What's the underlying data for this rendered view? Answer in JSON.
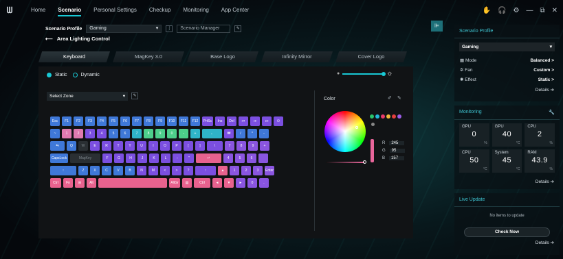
{
  "topbar": {
    "logo": "ᗯ",
    "nav": [
      "Home",
      "Scenario",
      "Personal Settings",
      "Checkup",
      "Monitoring",
      "App Center"
    ],
    "active": "Scenario",
    "icons": [
      "✋",
      "🎧",
      "⚙",
      "—",
      "⧉",
      "✕"
    ]
  },
  "scenario": {
    "profile_label": "Scenario Profile",
    "profile_value": "Gaming",
    "manager": "Scenario Manager",
    "page_title": "Area Lighting Control"
  },
  "tabs": [
    "Keyboard",
    "MagKey 3.0",
    "Base Logo",
    "Infinity Mirror",
    "Cover Logo"
  ],
  "lighting": {
    "static": "Static",
    "dynamic": "Dynamic",
    "zone": "Select Zone",
    "color_label": "Color",
    "r": "245",
    "g": "95",
    "b": "157",
    "r_label": "R",
    "g_label": "G",
    "b_label": "B"
  },
  "swatches": [
    "#29c46a",
    "#22b8d8",
    "#e93b6a",
    "#f0b93a",
    "#e33f3f",
    "#9b5de5"
  ],
  "keyboard": [
    [
      [
        "Esc",
        "k-blue",
        14
      ],
      [
        "F1",
        "k-blue",
        14
      ],
      [
        "F2",
        "k-blue",
        14
      ],
      [
        "F3",
        "k-blue",
        14
      ],
      [
        "F4",
        "k-blue",
        14
      ],
      [
        "F5",
        "k-blue",
        14
      ],
      [
        "F6",
        "k-blue",
        14
      ],
      [
        "F7",
        "k-blue",
        14
      ],
      [
        "F8",
        "k-blue",
        14
      ],
      [
        "F9",
        "k-blue",
        14
      ],
      [
        "F10",
        "k-blue",
        14
      ],
      [
        "F11",
        "k-blue",
        14
      ],
      [
        "F12",
        "k-blue",
        14
      ],
      [
        "PrtSc",
        "k-purple",
        16
      ],
      [
        "Ins",
        "k-purple",
        14
      ],
      [
        "Del",
        "k-purple",
        14
      ],
      [
        "⏮",
        "k-purple",
        14
      ],
      [
        "⏯",
        "k-purple",
        14
      ],
      [
        "⏭",
        "k-purple",
        14
      ],
      [
        "⏻",
        "k-purple",
        14
      ]
    ],
    [
      [
        "~",
        "k-blue",
        14
      ],
      [
        "1",
        "k-pink",
        14
      ],
      [
        "2",
        "k-pink",
        14
      ],
      [
        "3",
        "k-purple",
        14
      ],
      [
        "4",
        "k-purple",
        14
      ],
      [
        "5",
        "k-blue",
        14
      ],
      [
        "6",
        "k-blue",
        14
      ],
      [
        "7",
        "k-teal",
        14
      ],
      [
        "8",
        "k-green",
        14
      ],
      [
        "9",
        "k-green",
        14
      ],
      [
        "0",
        "k-green",
        14
      ],
      [
        "-",
        "k-green",
        14
      ],
      [
        "+",
        "k-teal",
        14
      ],
      [
        "←",
        "k-teal",
        29
      ],
      [
        "₩",
        "k-purple",
        14
      ],
      [
        "/",
        "k-blue",
        14
      ],
      [
        "*",
        "k-blue",
        14
      ],
      [
        "-",
        "k-blue",
        14
      ]
    ],
    [
      [
        "⇆",
        "k-blue",
        21
      ],
      [
        "Q",
        "k-blue",
        14
      ],
      [
        "W",
        "k-gray",
        14
      ],
      [
        "E",
        "k-purple",
        14
      ],
      [
        "R",
        "k-purple",
        14
      ],
      [
        "T",
        "k-purple",
        14
      ],
      [
        "Y",
        "k-purple",
        14
      ],
      [
        "U",
        "k-purple",
        14
      ],
      [
        "I",
        "k-purple",
        14
      ],
      [
        "O",
        "k-purple",
        14
      ],
      [
        "P",
        "k-purple",
        14
      ],
      [
        "[",
        "k-purple",
        14
      ],
      [
        "]",
        "k-purple",
        14
      ],
      [
        "\\",
        "k-purple",
        23
      ],
      [
        "7",
        "k-mag",
        14
      ],
      [
        "8",
        "k-mag",
        14
      ],
      [
        "9",
        "k-mag",
        14
      ],
      [
        "+",
        "k-mag",
        14
      ]
    ],
    [
      [
        "CapsLock",
        "k-blue",
        26
      ],
      [
        "MagKey",
        "k-gray",
        44
      ],
      [
        "F",
        "k-purple",
        14
      ],
      [
        "G",
        "k-purple",
        14
      ],
      [
        "H",
        "k-purple",
        14
      ],
      [
        "J",
        "k-purple",
        14
      ],
      [
        "K",
        "k-purple",
        14
      ],
      [
        "L",
        "k-purple",
        14
      ],
      [
        ":",
        "k-purple",
        14
      ],
      [
        "\"",
        "k-purple",
        14
      ],
      [
        "↵",
        "k-rose",
        37
      ],
      [
        "4",
        "k-mag",
        14
      ],
      [
        "5",
        "k-mag",
        14
      ],
      [
        "6",
        "k-mag",
        14
      ],
      [
        "",
        "k-mag",
        14
      ]
    ],
    [
      [
        "↑",
        "k-blue",
        38
      ],
      [
        "Z",
        "k-blue",
        14
      ],
      [
        "X",
        "k-blue",
        14
      ],
      [
        "C",
        "k-blue",
        14
      ],
      [
        "V",
        "k-blue",
        14
      ],
      [
        "B",
        "k-blue",
        14
      ],
      [
        "N",
        "k-purple",
        14
      ],
      [
        "M",
        "k-purple",
        14
      ],
      [
        "<",
        "k-purple",
        14
      ],
      [
        ">",
        "k-purple",
        14
      ],
      [
        "?",
        "k-purple",
        14
      ],
      [
        "↑",
        "k-purple",
        30
      ],
      [
        "▲",
        "k-rose",
        14
      ],
      [
        "1",
        "k-mag",
        14
      ],
      [
        "2",
        "k-mag",
        14
      ],
      [
        "3",
        "k-mag",
        14
      ],
      [
        "Enter",
        "k-mag",
        14
      ]
    ],
    [
      [
        "Ctrl",
        "k-rose",
        16
      ],
      [
        "Fn",
        "k-rose",
        14
      ],
      [
        "⊞",
        "k-rose",
        14
      ],
      [
        "Alt",
        "k-rose",
        14
      ],
      [
        "",
        "k-rose",
        100
      ],
      [
        "AltGr",
        "k-rose",
        16
      ],
      [
        "▤",
        "k-rose",
        14
      ],
      [
        "Ctrl",
        "k-rose",
        24
      ],
      [
        "◄",
        "k-rose",
        14
      ],
      [
        "▼",
        "k-rose",
        14
      ],
      [
        "►",
        "k-mag",
        14
      ],
      [
        "0",
        "k-mag",
        14
      ],
      [
        ".",
        "k-mag",
        14
      ]
    ]
  ],
  "side": {
    "profile_title": "Scenario Profile",
    "profile_value": "Gaming",
    "rows": [
      {
        "label": "Mode",
        "value": "Balanced >"
      },
      {
        "label": "Fan",
        "value": "Custom >"
      },
      {
        "label": "Effect",
        "value": "Static >"
      }
    ],
    "details": "Details ➔",
    "monitoring_title": "Monitoring",
    "mon": [
      {
        "l": "GPU",
        "v": "0",
        "u": "%"
      },
      {
        "l": "GPU",
        "v": "40",
        "u": "°C"
      },
      {
        "l": "CPU",
        "v": "2",
        "u": "%"
      },
      {
        "l": "CPU",
        "v": "50",
        "u": "°C"
      },
      {
        "l": "System",
        "v": "45",
        "u": "°C"
      },
      {
        "l": "RAM",
        "v": "43.9",
        "u": "%"
      }
    ],
    "live_title": "Live Update",
    "live_empty": "No items to update",
    "check": "Check Now"
  }
}
